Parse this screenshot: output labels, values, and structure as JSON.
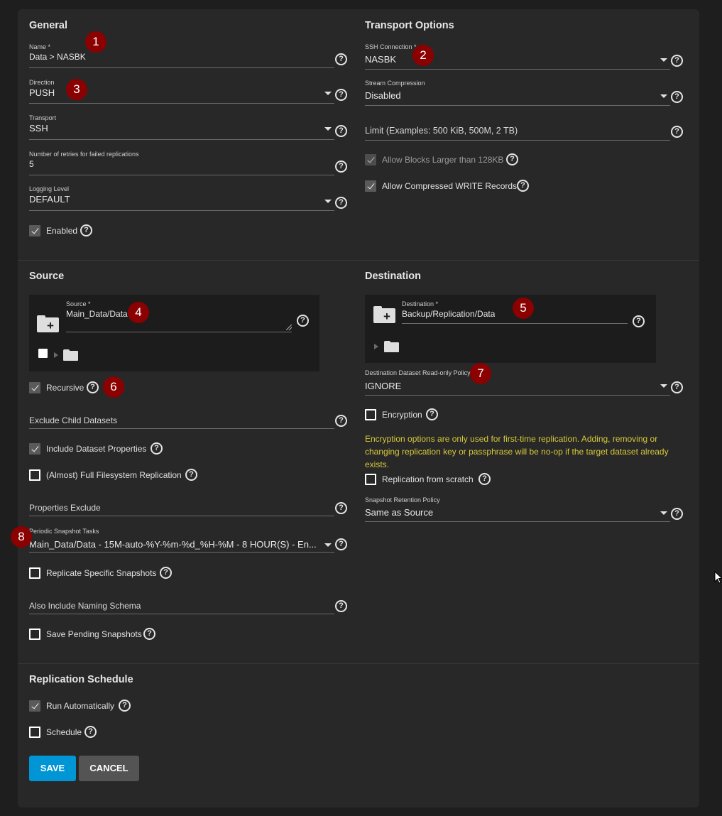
{
  "general": {
    "title": "General",
    "name": {
      "label": "Name *",
      "value": "Data > NASBK"
    },
    "direction": {
      "label": "Direction",
      "value": "PUSH"
    },
    "transport": {
      "label": "Transport",
      "value": "SSH"
    },
    "retries": {
      "label": "Number of retries for failed replications",
      "value": "5"
    },
    "logging": {
      "label": "Logging Level",
      "value": "DEFAULT"
    },
    "enabled": {
      "label": "Enabled",
      "checked": true
    }
  },
  "transport_options": {
    "title": "Transport Options",
    "ssh_connection": {
      "label": "SSH Connection *",
      "value": "NASBK"
    },
    "stream_compression": {
      "label": "Stream Compression",
      "value": "Disabled"
    },
    "limit": {
      "placeholder": "Limit (Examples: 500 KiB, 500M, 2 TB)"
    },
    "allow_large_blocks": {
      "label": "Allow Blocks Larger than 128KB",
      "checked": true,
      "disabled": true
    },
    "allow_compressed": {
      "label": "Allow Compressed WRITE Records",
      "checked": true
    }
  },
  "source": {
    "title": "Source",
    "source_field": {
      "label": "Source *",
      "value": "Main_Data/Data"
    },
    "recursive": {
      "label": "Recursive",
      "checked": true
    },
    "exclude_child": {
      "placeholder": "Exclude Child Datasets"
    },
    "include_props": {
      "label": "Include Dataset Properties",
      "checked": true
    },
    "full_fs": {
      "label": "(Almost) Full Filesystem Replication",
      "checked": false
    },
    "props_exclude": {
      "placeholder": "Properties Exclude"
    },
    "periodic_tasks": {
      "label": "Periodic Snapshot Tasks",
      "value": "Main_Data/Data - 15M-auto-%Y-%m-%d_%H-%M - 8 HOUR(S) - En..."
    },
    "replicate_specific": {
      "label": "Replicate Specific Snapshots",
      "checked": false
    },
    "naming_schema": {
      "placeholder": "Also Include Naming Schema"
    },
    "save_pending": {
      "label": "Save Pending Snapshots",
      "checked": false
    }
  },
  "destination": {
    "title": "Destination",
    "dest_field": {
      "label": "Destination *",
      "value": "Backup/Replication/Data"
    },
    "readonly_policy": {
      "label": "Destination Dataset Read-only Policy",
      "value": "IGNORE"
    },
    "encryption": {
      "label": "Encryption",
      "checked": false
    },
    "warning": "Encryption options are only used for first-time replication. Adding, removing or changing replication key or passphrase will be no-op if the target dataset already exists.",
    "from_scratch": {
      "label": "Replication from scratch",
      "checked": false
    },
    "retention": {
      "label": "Snapshot Retention Policy",
      "value": "Same as Source"
    }
  },
  "schedule": {
    "title": "Replication Schedule",
    "run_auto": {
      "label": "Run Automatically",
      "checked": true
    },
    "schedule": {
      "label": "Schedule",
      "checked": false
    }
  },
  "actions": {
    "save": "SAVE",
    "cancel": "CANCEL"
  },
  "help_glyph": "?",
  "plus_glyph": "+",
  "badges": [
    "1",
    "2",
    "3",
    "4",
    "5",
    "6",
    "7",
    "8"
  ],
  "colors": {
    "accent": "#0095d5",
    "badge": "#8b0000",
    "warning": "#d7c83a",
    "card": "#282828",
    "background": "#1e1e1e"
  }
}
